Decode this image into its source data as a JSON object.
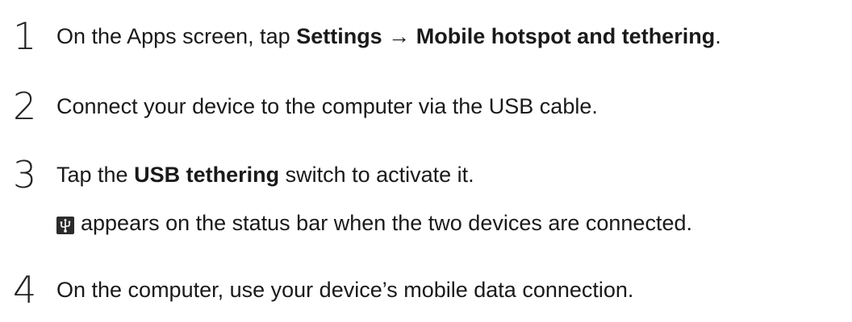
{
  "steps": [
    {
      "number": "1",
      "parts": [
        {
          "text": "On the Apps screen, tap ",
          "bold": false
        },
        {
          "text": "Settings",
          "bold": true
        },
        {
          "text": " → ",
          "bold": true
        },
        {
          "text": "Mobile hotspot and tethering",
          "bold": true
        },
        {
          "text": ".",
          "bold": false
        }
      ]
    },
    {
      "number": "2",
      "parts": [
        {
          "text": "Connect your device to the computer via the USB cable.",
          "bold": false
        }
      ]
    },
    {
      "number": "3",
      "parts": [
        {
          "text": "Tap the ",
          "bold": false
        },
        {
          "text": "USB tethering",
          "bold": true
        },
        {
          "text": " switch to activate it.",
          "bold": false
        }
      ],
      "note": {
        "icon": "usb-icon",
        "text": "appears on the status bar when the two devices are connected."
      }
    },
    {
      "number": "4",
      "parts": [
        {
          "text": "On the computer, use your device’s mobile data connection.",
          "bold": false
        }
      ]
    }
  ]
}
